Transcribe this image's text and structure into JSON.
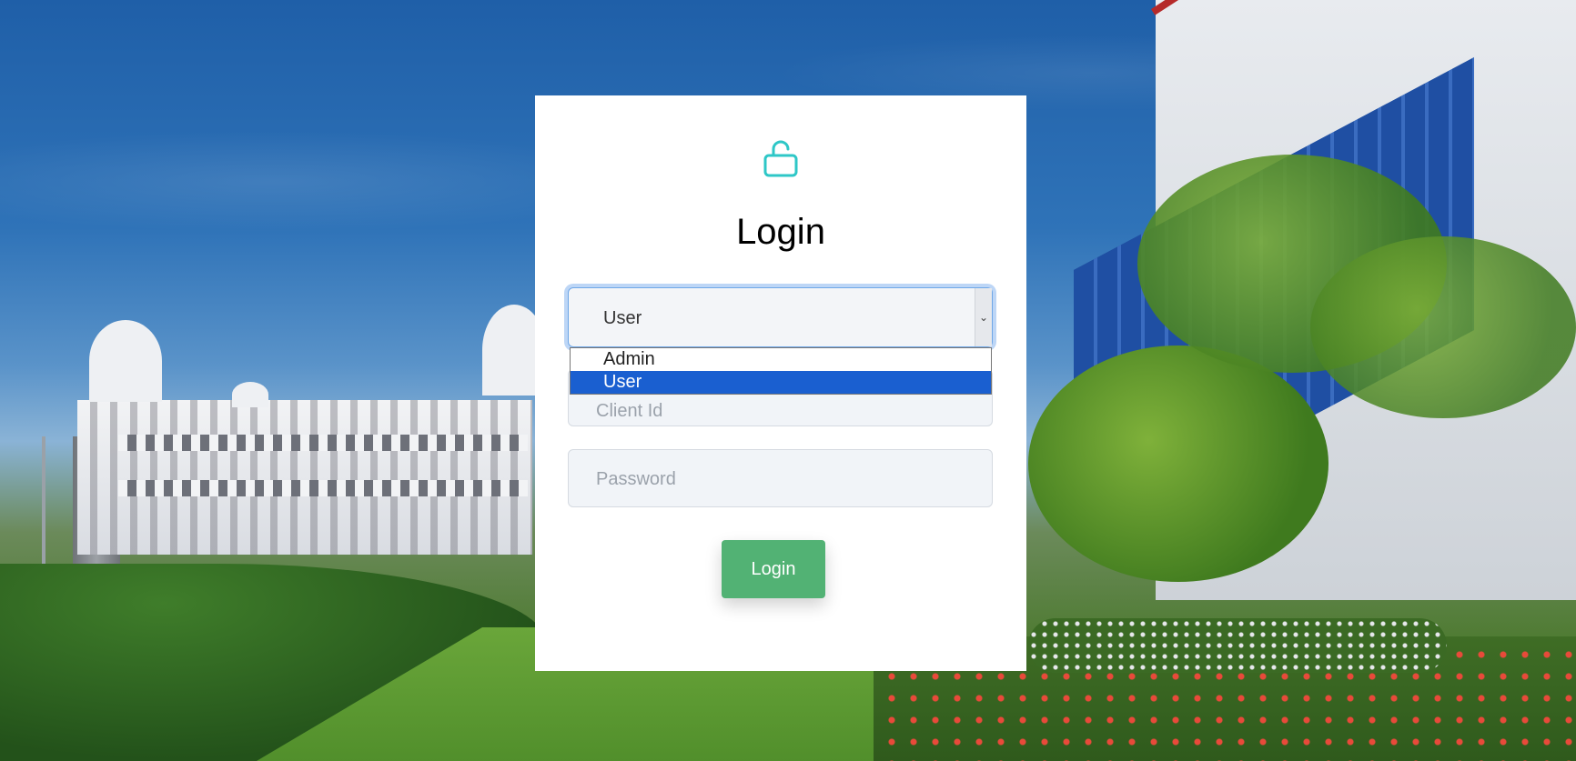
{
  "login_card": {
    "title": "Login",
    "role_select": {
      "value": "User",
      "options": [
        "Admin",
        "User"
      ],
      "selected_option": "User"
    },
    "client_id_placeholder": "Client Id",
    "password_placeholder": "Password",
    "login_button_label": "Login"
  },
  "colors": {
    "accent_icon": "#2ec7c7",
    "button": "#52b274",
    "selected_option": "#1a5fd0"
  },
  "icons": {
    "lock": "unlock-icon"
  }
}
